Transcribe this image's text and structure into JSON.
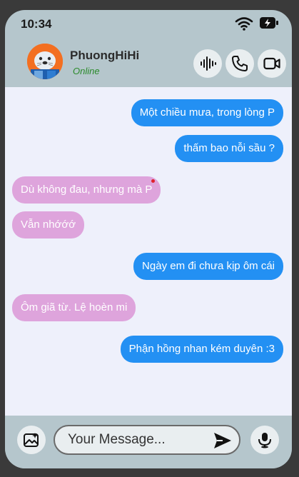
{
  "status_bar": {
    "time": "10:34"
  },
  "contact": {
    "name": "PhuongHiHi",
    "status": "Online"
  },
  "header_actions": [
    {
      "icon": "voice-wave-icon"
    },
    {
      "icon": "phone-icon"
    },
    {
      "icon": "video-camera-icon"
    }
  ],
  "messages": [
    {
      "direction": "outgoing",
      "text": "Một chiều mưa, trong lòng P"
    },
    {
      "direction": "outgoing",
      "text": "thấm bao nỗi sầu ?"
    },
    {
      "direction": "incoming",
      "text": "Dù không đau, nhưng mà P"
    },
    {
      "direction": "incoming",
      "text": "Vẫn nhớớớ"
    },
    {
      "direction": "outgoing",
      "text": "Ngày em đi chưa kịp ôm cái"
    },
    {
      "direction": "incoming",
      "text": "Ôm giã từ. Lệ hoèn mi"
    },
    {
      "direction": "outgoing",
      "text": "Phận hồng nhan kém duyên :3"
    }
  ],
  "composer": {
    "placeholder": "Your Message...",
    "left_icon": "image-sparkle-icon",
    "send_icon": "send-icon",
    "right_icon": "microphone-icon"
  },
  "colors": {
    "outgoing_bubble": "#2390f3",
    "incoming_bubble": "#dea4dc",
    "online": "#2a8a2a",
    "header_bg": "#b5c6cc",
    "chat_bg": "#eef0fb"
  }
}
